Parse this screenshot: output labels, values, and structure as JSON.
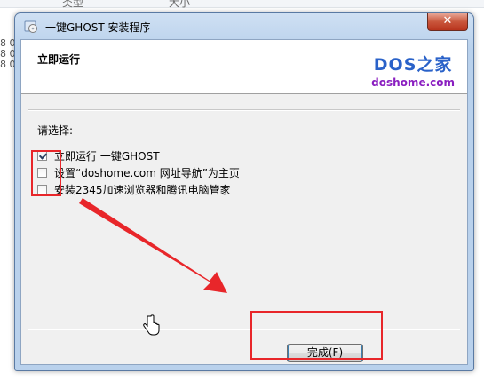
{
  "background": {
    "col1": "类型",
    "col2": "大小",
    "row_prefix": "8 0"
  },
  "window": {
    "title": "一键GHOST 安装程序",
    "close_glyph": "✕",
    "header_title": "立即运行",
    "brand_logo": "DOS之家",
    "brand_url": "doshome.com",
    "prompt": "请选择:",
    "options": [
      {
        "label": "立即运行 一键GHOST",
        "checked": true
      },
      {
        "label": "设置“doshome.com 网址导航”为主页",
        "checked": false
      },
      {
        "label": "安装2345加速浏览器和腾讯电脑管家",
        "checked": false
      }
    ],
    "finish_button": "完成(F)"
  },
  "colors": {
    "annotation_red": "#e8262a",
    "brand_blue": "#2a62c9",
    "brand_purple": "#8a1ec0"
  },
  "icons": [
    "app-icon",
    "close-icon",
    "mouse-cursor-icon"
  ]
}
